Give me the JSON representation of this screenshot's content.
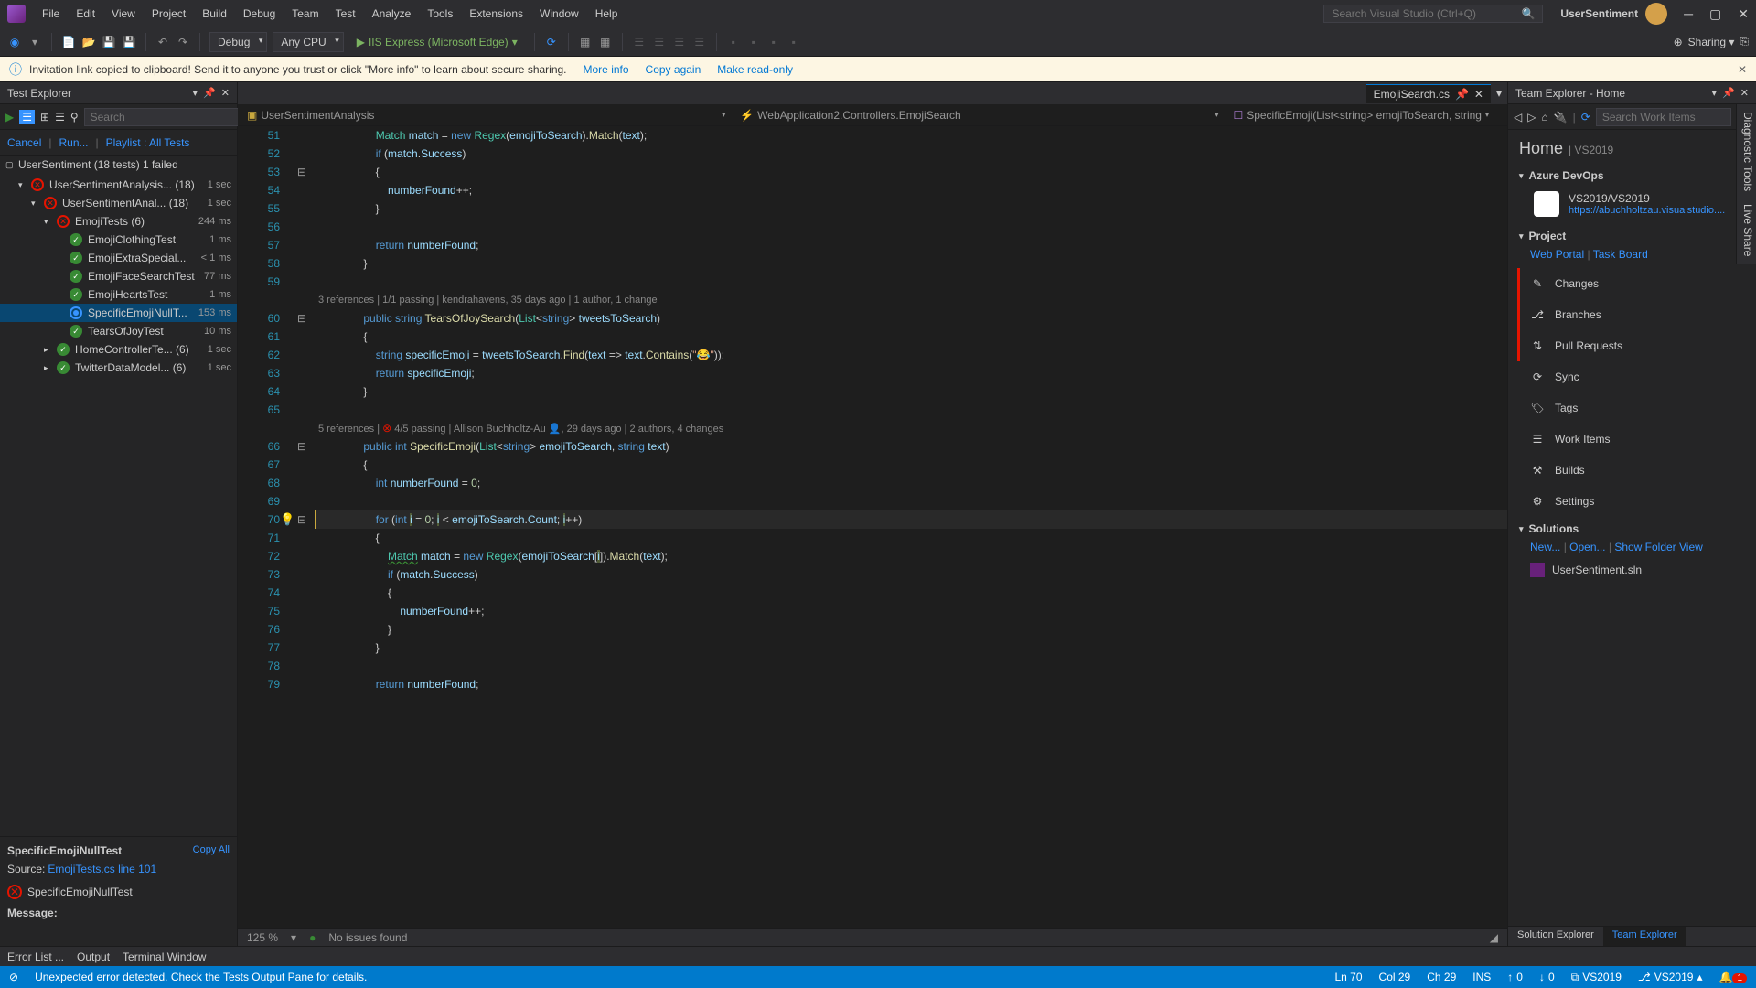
{
  "menu": [
    "File",
    "Edit",
    "View",
    "Project",
    "Build",
    "Debug",
    "Team",
    "Test",
    "Analyze",
    "Tools",
    "Extensions",
    "Window",
    "Help"
  ],
  "search_placeholder": "Search Visual Studio (Ctrl+Q)",
  "solution_name": "UserSentiment",
  "toolbar": {
    "config": "Debug",
    "platform": "Any CPU",
    "run_target": "IIS Express (Microsoft Edge)",
    "sharing": "Sharing"
  },
  "notification": {
    "text": "Invitation link copied to clipboard! Send it to anyone you trust or click \"More info\" to learn about secure sharing.",
    "more_info": "More info",
    "copy_again": "Copy again",
    "make_readonly": "Make read-only"
  },
  "test_explorer": {
    "title": "Test Explorer",
    "search_placeholder": "Search",
    "cancel": "Cancel",
    "run": "Run...",
    "playlist": "Playlist : All Tests",
    "root": {
      "name": "UserSentiment (18 tests) 1 failed"
    },
    "rows": [
      {
        "indent": 1,
        "expand": "▾",
        "status": "fail",
        "name": "UserSentimentAnalysis... (18)",
        "time": "1 sec"
      },
      {
        "indent": 2,
        "expand": "▾",
        "status": "fail",
        "name": "UserSentimentAnal... (18)",
        "time": "1 sec"
      },
      {
        "indent": 3,
        "expand": "▾",
        "status": "fail",
        "name": "EmojiTests (6)",
        "time": "244 ms"
      },
      {
        "indent": 4,
        "expand": "",
        "status": "pass",
        "name": "EmojiClothingTest",
        "time": "1 ms"
      },
      {
        "indent": 4,
        "expand": "",
        "status": "pass",
        "name": "EmojiExtraSpecial...",
        "time": "< 1 ms"
      },
      {
        "indent": 4,
        "expand": "",
        "status": "pass",
        "name": "EmojiFaceSearchTest",
        "time": "77 ms"
      },
      {
        "indent": 4,
        "expand": "",
        "status": "pass",
        "name": "EmojiHeartsTest",
        "time": "1 ms"
      },
      {
        "indent": 4,
        "expand": "",
        "status": "running",
        "name": "SpecificEmojiNullT...",
        "time": "153 ms",
        "selected": true
      },
      {
        "indent": 4,
        "expand": "",
        "status": "pass",
        "name": "TearsOfJoyTest",
        "time": "10 ms"
      },
      {
        "indent": 3,
        "expand": "▸",
        "status": "pass",
        "name": "HomeControllerTe... (6)",
        "time": "1 sec"
      },
      {
        "indent": 3,
        "expand": "▸",
        "status": "pass",
        "name": "TwitterDataModel... (6)",
        "time": "1 sec"
      }
    ],
    "detail": {
      "title": "SpecificEmojiNullTest",
      "copy_all": "Copy All",
      "source_label": "Source:",
      "source_link": "EmojiTests.cs line 101",
      "fail_name": "SpecificEmojiNullTest",
      "message_label": "Message:"
    }
  },
  "editor": {
    "tab_name": "EmojiSearch.cs",
    "breadcrumb": {
      "project": "UserSentimentAnalysis",
      "namespace": "WebApplication2.Controllers.EmojiSearch",
      "member": "SpecificEmoji(List<string> emojiToSearch, string"
    },
    "codelens1": "3 references | 1/1 passing | kendrahavens, 35 days ago | 1 author, 1 change",
    "codelens2_pre": "5 references | ",
    "codelens2_mid": " 4/5 passing | Allison Buchholtz-Au ",
    "codelens2_post": ", 29 days ago | 2 authors, 4 changes",
    "zoom": "125 %",
    "issues": "No issues found"
  },
  "team_explorer": {
    "title": "Team Explorer - Home",
    "search_placeholder": "Search Work Items",
    "home": "Home",
    "home_sub": "| VS2019",
    "azure_devops": "Azure DevOps",
    "devops_name": "VS2019/VS2019",
    "devops_url": "https://abuchholtzau.visualstudio....",
    "project": "Project",
    "web_portal": "Web Portal",
    "task_board": "Task Board",
    "actions": [
      {
        "icon": "✎",
        "label": "Changes",
        "accent": true
      },
      {
        "icon": "⎇",
        "label": "Branches",
        "accent": true
      },
      {
        "icon": "⇅",
        "label": "Pull Requests",
        "accent": true
      },
      {
        "icon": "⟳",
        "label": "Sync",
        "accent": false
      },
      {
        "icon": "🏷",
        "label": "Tags",
        "accent": false
      },
      {
        "icon": "☰",
        "label": "Work Items",
        "accent": false
      },
      {
        "icon": "⚒",
        "label": "Builds",
        "accent": false
      },
      {
        "icon": "⚙",
        "label": "Settings",
        "accent": false
      }
    ],
    "solutions": "Solutions",
    "new": "New...",
    "open": "Open...",
    "show_folder": "Show Folder View",
    "solution_file": "UserSentiment.sln",
    "tab_solution": "Solution Explorer",
    "tab_team": "Team Explorer"
  },
  "side_tabs": [
    "Diagnostic Tools",
    "Live Share"
  ],
  "bottom_tabs": [
    "Error List ...",
    "Output",
    "Terminal Window"
  ],
  "status": {
    "error_msg": "Unexpected error detected. Check the Tests Output Pane for details.",
    "ln": "Ln 70",
    "col": "Col 29",
    "ch": "Ch 29",
    "ins": "INS",
    "up": "0",
    "down": "0",
    "repo": "VS2019",
    "branch": "VS2019",
    "notif": "1"
  }
}
